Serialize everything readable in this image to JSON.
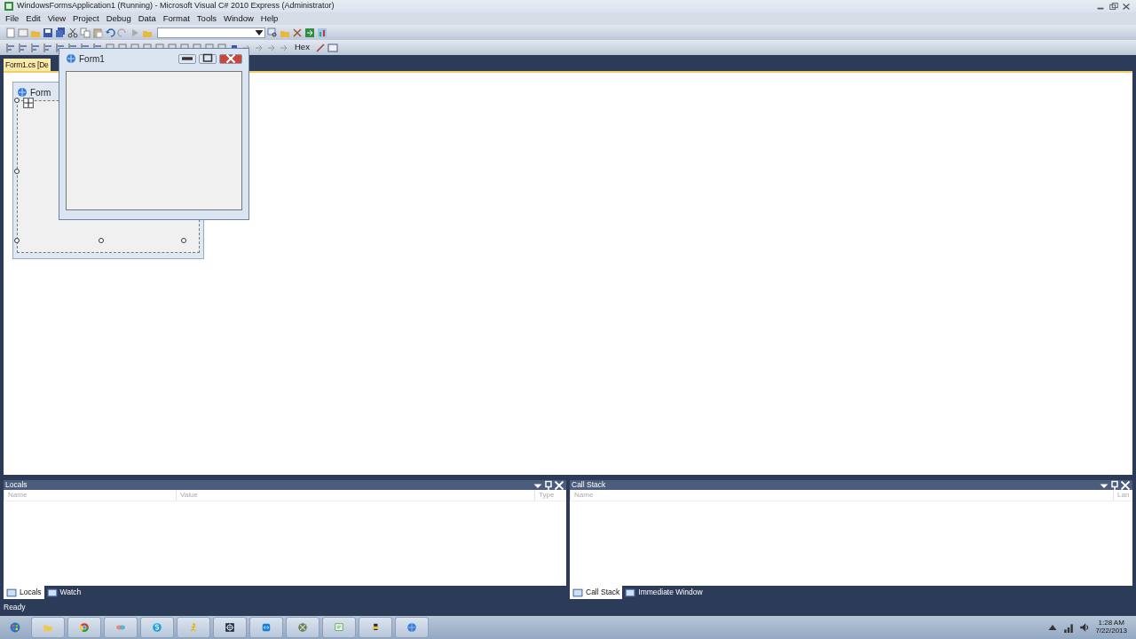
{
  "window": {
    "title": "WindowsFormsApplication1 (Running) - Microsoft Visual C# 2010 Express (Administrator)"
  },
  "menu": [
    "File",
    "Edit",
    "View",
    "Project",
    "Debug",
    "Data",
    "Format",
    "Tools",
    "Window",
    "Help"
  ],
  "toolbar": {
    "hex_label": "Hex"
  },
  "document_tabs": [
    {
      "label": "Form1.cs [De",
      "selected": true
    }
  ],
  "designer_form": {
    "title": "Form"
  },
  "running_form": {
    "title": "Form1"
  },
  "panels": [
    {
      "title": "Locals",
      "columns": [
        "Name",
        "Value",
        "Type"
      ],
      "tabs": [
        {
          "label": "Locals",
          "selected": true
        },
        {
          "label": "Watch",
          "selected": false
        }
      ]
    },
    {
      "title": "Call Stack",
      "columns": [
        "Name",
        "Lan"
      ],
      "tabs": [
        {
          "label": "Call Stack",
          "selected": true
        },
        {
          "label": "Immediate Window",
          "selected": false
        }
      ]
    }
  ],
  "status_bar": {
    "text": "Ready"
  },
  "taskbar": {
    "time": "1:28 AM",
    "date": "7/22/2013"
  }
}
